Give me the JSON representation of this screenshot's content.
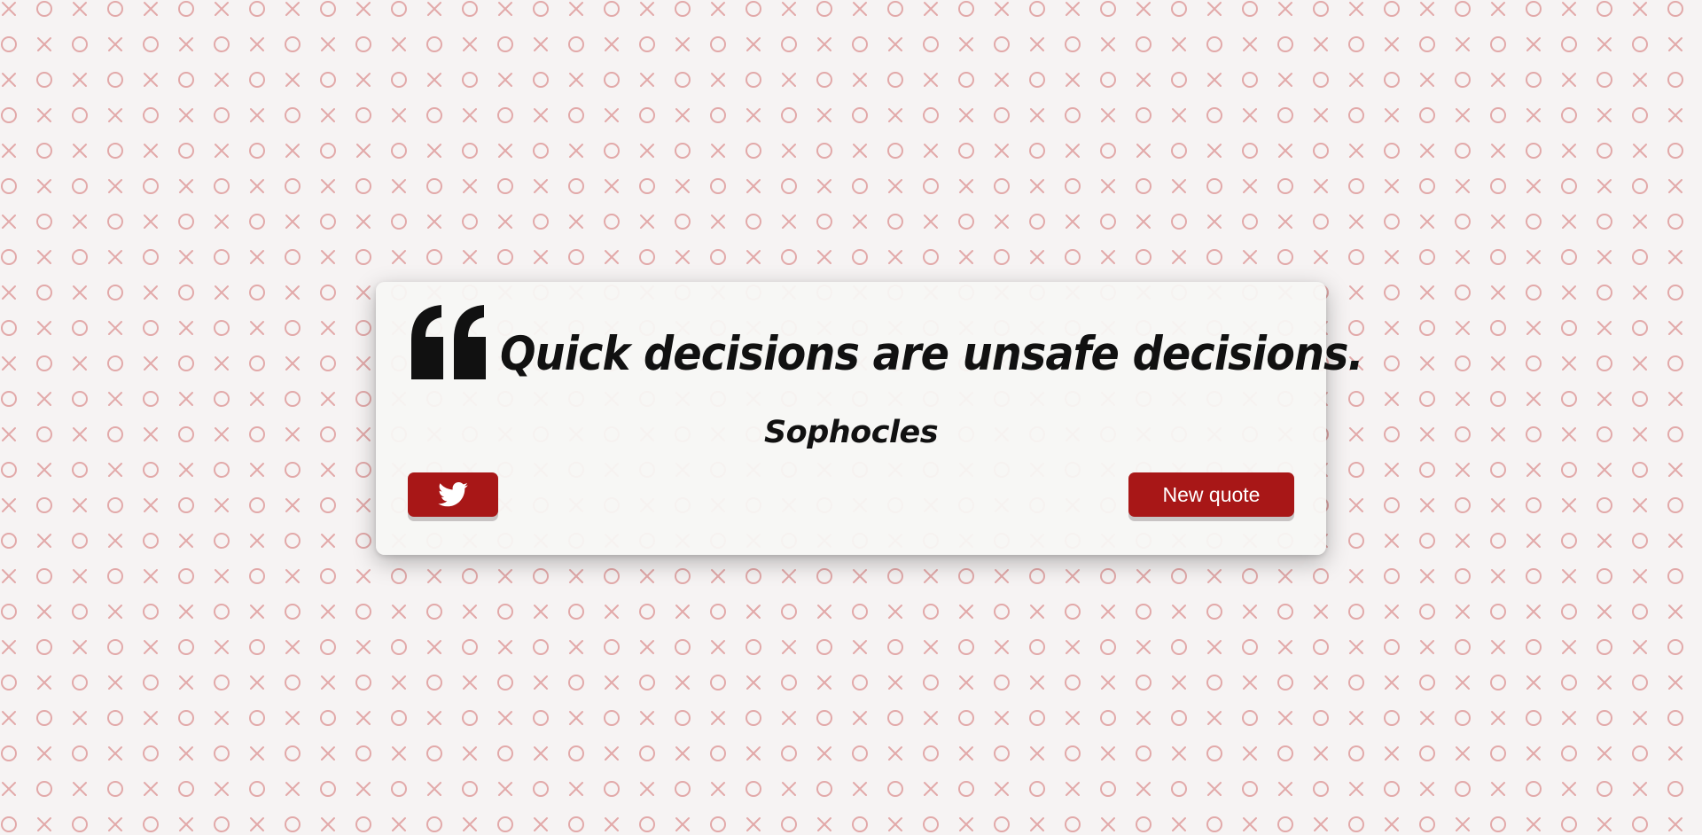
{
  "colors": {
    "background": "#f6f3f3",
    "pattern": "#e2a9a9",
    "accent": "#a81717",
    "card": "#f7f6f4",
    "text": "#111111"
  },
  "background_pattern": {
    "symbols": [
      "×",
      "○"
    ]
  },
  "quote": {
    "icon": "quote-left-icon",
    "text": "Quick decisions are unsafe decisions.",
    "author": "Sophocles"
  },
  "buttons": {
    "tweet": {
      "icon": "twitter-icon"
    },
    "new_quote_label": "New quote"
  }
}
